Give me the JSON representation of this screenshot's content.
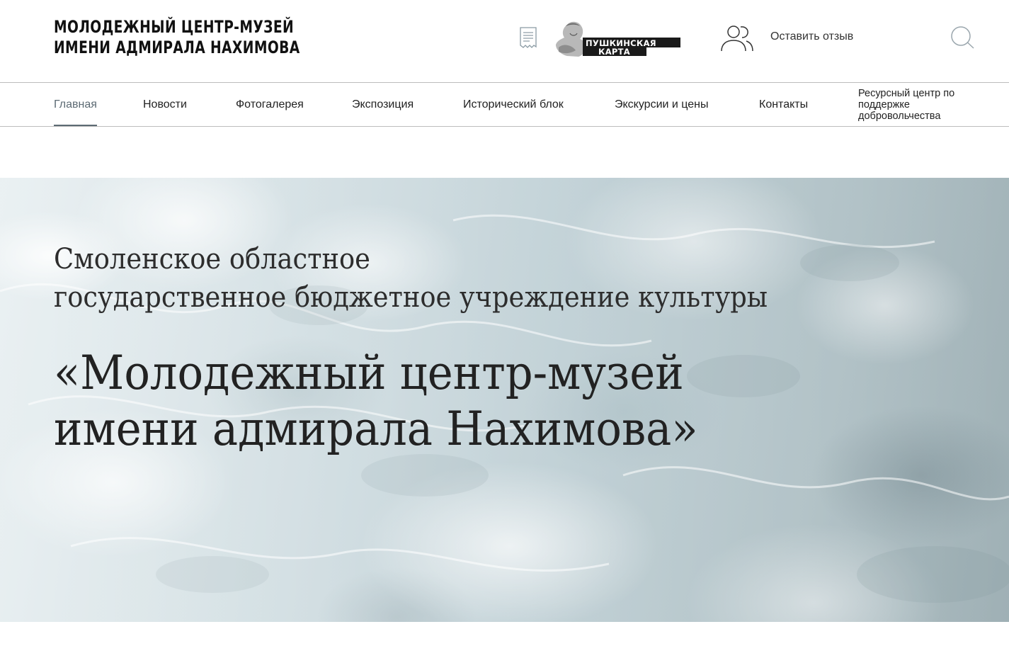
{
  "header": {
    "logo_line1": "МОЛОДЕЖНЫЙ ЦЕНТР-МУЗЕЙ",
    "logo_line2": "ИМЕНИ АДМИРАЛА НАХИМОВА",
    "pushkin_card_line1": "ПУШКИНСКАЯ",
    "pushkin_card_line2": "КАРТА",
    "feedback_label": "Оставить отзыв",
    "icons": [
      "document-icon",
      "users-icon",
      "search-icon"
    ]
  },
  "nav": {
    "items": [
      {
        "label": "Главная",
        "active": true
      },
      {
        "label": "Новости"
      },
      {
        "label": "Фотогалерея"
      },
      {
        "label": "Экспозиция"
      },
      {
        "label": "Исторический блок"
      },
      {
        "label": "Экскурсии и цены"
      },
      {
        "label": "Контакты"
      },
      {
        "label": "Ресурсный центр по поддержке добровольчества"
      }
    ]
  },
  "hero": {
    "subtitle_line1": "Смоленское областное",
    "subtitle_line2": "государственное бюджетное учреждение культуры",
    "title_line1": "«Молодежный центр-музей",
    "title_line2": "имени адмирала Нахимова»"
  },
  "colors": {
    "active_nav": "#5d6b74",
    "divider": "#bdbdbd",
    "text": "#222222"
  }
}
